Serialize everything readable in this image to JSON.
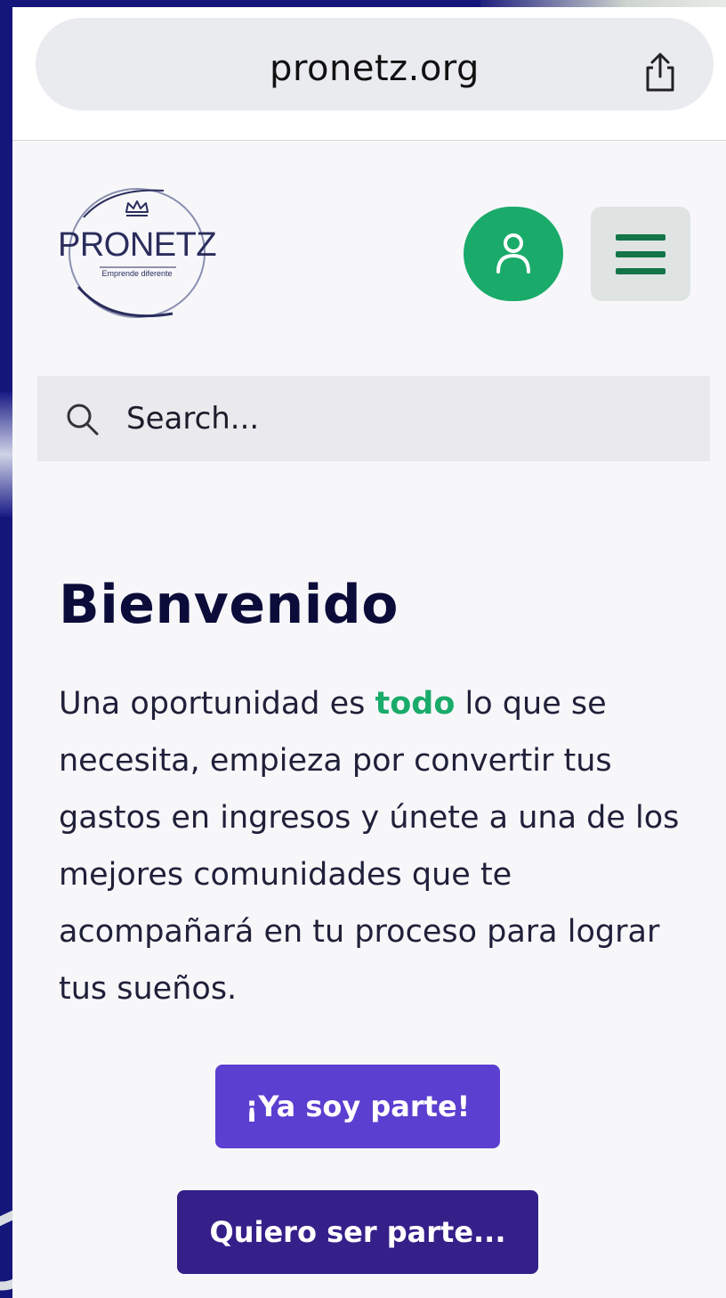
{
  "browser": {
    "url": "pronetz.org",
    "share_icon": "share-icon"
  },
  "header": {
    "logo": {
      "wordmark": "PRONETZ",
      "tagline": "Emprende diferente"
    },
    "user_icon": "user-icon",
    "menu_icon": "hamburger-menu-icon"
  },
  "search": {
    "placeholder": "Search...",
    "value": ""
  },
  "hero": {
    "title": "Bienvenido",
    "text_before": "Una oportunidad es ",
    "text_accent": "todo",
    "text_after": " lo que se necesita, empieza por convertir tus gastos en ingresos y únete a una de los mejores comunidades que te acompañará en tu proceso para lograr tus sueños."
  },
  "buttons": {
    "primary_label": "¡Ya soy parte!",
    "secondary_label": "Quiero ser parte..."
  },
  "colors": {
    "accent_green": "#1aab6a",
    "primary_purple": "#5b3fd0",
    "secondary_purple": "#35208a",
    "heading": "#0c0c3a"
  }
}
